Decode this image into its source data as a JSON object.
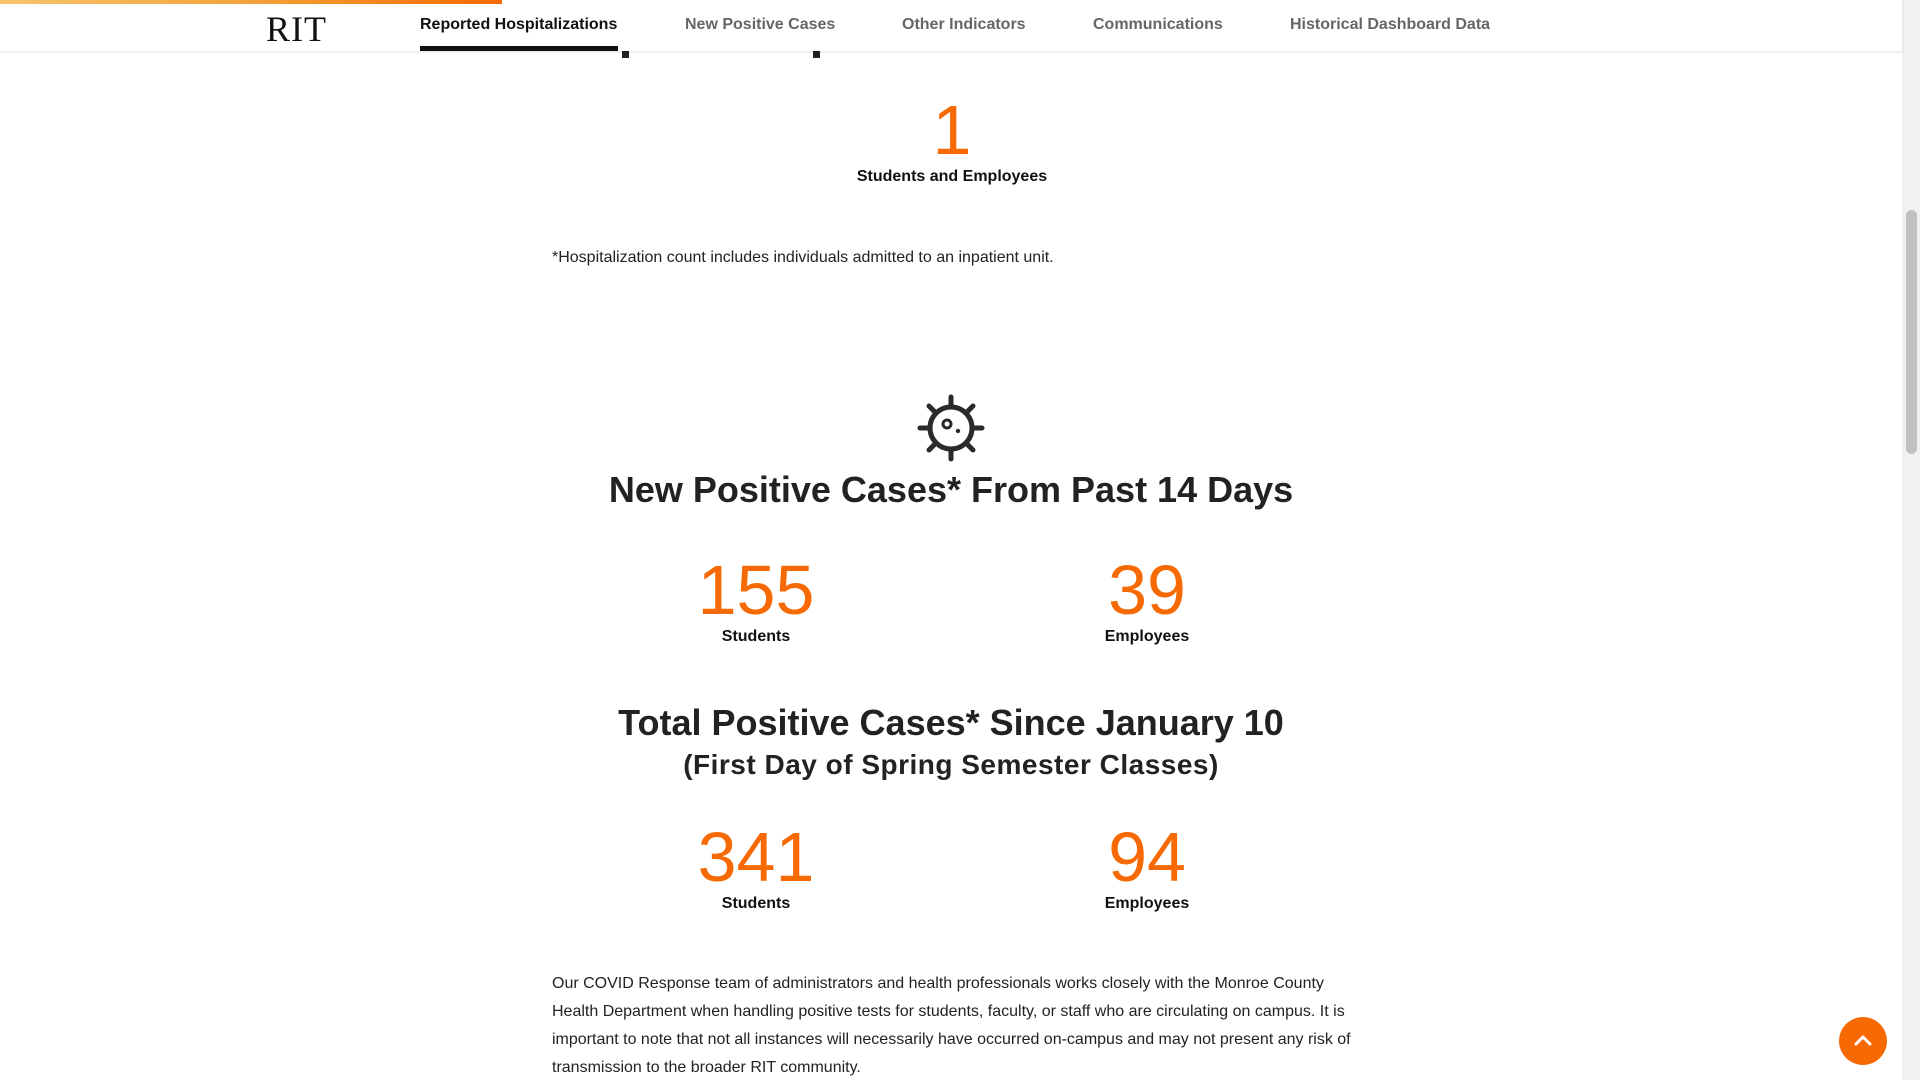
{
  "nav": {
    "logo": "RIT",
    "items": [
      {
        "label": "Reported Hospitalizations",
        "active": true
      },
      {
        "label": "New Positive Cases",
        "active": false
      },
      {
        "label": "Other Indicators",
        "active": false
      },
      {
        "label": "Communications",
        "active": false
      },
      {
        "label": "Historical Dashboard Data",
        "active": false
      }
    ]
  },
  "hospitalizations": {
    "count": "1",
    "label": "Students and Employees",
    "note": "*Hospitalization count includes individuals admitted to an inpatient unit."
  },
  "new_cases": {
    "icon": "virus-icon",
    "title": "New Positive Cases* From Past 14 Days",
    "students_count": "155",
    "students_label": "Students",
    "employees_count": "39",
    "employees_label": "Employees"
  },
  "total_cases": {
    "title": "Total Positive Cases* Since January 10",
    "subtitle": "(First Day of Spring Semester Classes)",
    "students_count": "341",
    "students_label": "Students",
    "employees_count": "94",
    "employees_label": "Employees"
  },
  "paragraph": "Our COVID Response team of administrators and health professionals works closely with the Monroe County Health Department when handling positive tests for students, faculty, or staff who are circulating on campus. It is important to note that not all instances will necessarily have occurred on-campus and may not present any risk of transmission to the broader RIT community.",
  "back_to_top": {
    "icon": "chevron-up-icon"
  },
  "colors": {
    "accent": "#f76902",
    "text": "#222222",
    "nav_inactive": "#666666"
  }
}
